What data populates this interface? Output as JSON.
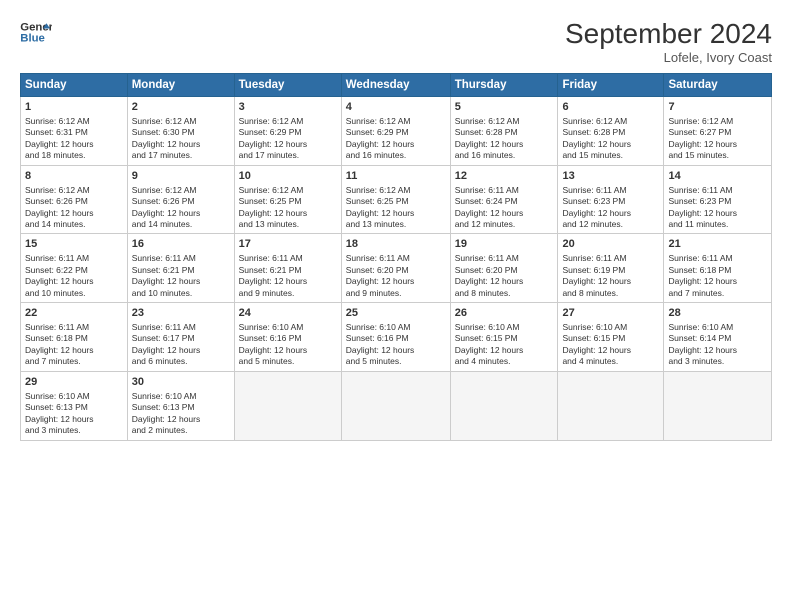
{
  "header": {
    "logo_line1": "General",
    "logo_line2": "Blue",
    "month_title": "September 2024",
    "subtitle": "Lofele, Ivory Coast"
  },
  "weekdays": [
    "Sunday",
    "Monday",
    "Tuesday",
    "Wednesday",
    "Thursday",
    "Friday",
    "Saturday"
  ],
  "weeks": [
    [
      {
        "day": "1",
        "lines": [
          "Sunrise: 6:12 AM",
          "Sunset: 6:31 PM",
          "Daylight: 12 hours",
          "and 18 minutes."
        ]
      },
      {
        "day": "2",
        "lines": [
          "Sunrise: 6:12 AM",
          "Sunset: 6:30 PM",
          "Daylight: 12 hours",
          "and 17 minutes."
        ]
      },
      {
        "day": "3",
        "lines": [
          "Sunrise: 6:12 AM",
          "Sunset: 6:29 PM",
          "Daylight: 12 hours",
          "and 17 minutes."
        ]
      },
      {
        "day": "4",
        "lines": [
          "Sunrise: 6:12 AM",
          "Sunset: 6:29 PM",
          "Daylight: 12 hours",
          "and 16 minutes."
        ]
      },
      {
        "day": "5",
        "lines": [
          "Sunrise: 6:12 AM",
          "Sunset: 6:28 PM",
          "Daylight: 12 hours",
          "and 16 minutes."
        ]
      },
      {
        "day": "6",
        "lines": [
          "Sunrise: 6:12 AM",
          "Sunset: 6:28 PM",
          "Daylight: 12 hours",
          "and 15 minutes."
        ]
      },
      {
        "day": "7",
        "lines": [
          "Sunrise: 6:12 AM",
          "Sunset: 6:27 PM",
          "Daylight: 12 hours",
          "and 15 minutes."
        ]
      }
    ],
    [
      {
        "day": "8",
        "lines": [
          "Sunrise: 6:12 AM",
          "Sunset: 6:26 PM",
          "Daylight: 12 hours",
          "and 14 minutes."
        ]
      },
      {
        "day": "9",
        "lines": [
          "Sunrise: 6:12 AM",
          "Sunset: 6:26 PM",
          "Daylight: 12 hours",
          "and 14 minutes."
        ]
      },
      {
        "day": "10",
        "lines": [
          "Sunrise: 6:12 AM",
          "Sunset: 6:25 PM",
          "Daylight: 12 hours",
          "and 13 minutes."
        ]
      },
      {
        "day": "11",
        "lines": [
          "Sunrise: 6:12 AM",
          "Sunset: 6:25 PM",
          "Daylight: 12 hours",
          "and 13 minutes."
        ]
      },
      {
        "day": "12",
        "lines": [
          "Sunrise: 6:11 AM",
          "Sunset: 6:24 PM",
          "Daylight: 12 hours",
          "and 12 minutes."
        ]
      },
      {
        "day": "13",
        "lines": [
          "Sunrise: 6:11 AM",
          "Sunset: 6:23 PM",
          "Daylight: 12 hours",
          "and 12 minutes."
        ]
      },
      {
        "day": "14",
        "lines": [
          "Sunrise: 6:11 AM",
          "Sunset: 6:23 PM",
          "Daylight: 12 hours",
          "and 11 minutes."
        ]
      }
    ],
    [
      {
        "day": "15",
        "lines": [
          "Sunrise: 6:11 AM",
          "Sunset: 6:22 PM",
          "Daylight: 12 hours",
          "and 10 minutes."
        ]
      },
      {
        "day": "16",
        "lines": [
          "Sunrise: 6:11 AM",
          "Sunset: 6:21 PM",
          "Daylight: 12 hours",
          "and 10 minutes."
        ]
      },
      {
        "day": "17",
        "lines": [
          "Sunrise: 6:11 AM",
          "Sunset: 6:21 PM",
          "Daylight: 12 hours",
          "and 9 minutes."
        ]
      },
      {
        "day": "18",
        "lines": [
          "Sunrise: 6:11 AM",
          "Sunset: 6:20 PM",
          "Daylight: 12 hours",
          "and 9 minutes."
        ]
      },
      {
        "day": "19",
        "lines": [
          "Sunrise: 6:11 AM",
          "Sunset: 6:20 PM",
          "Daylight: 12 hours",
          "and 8 minutes."
        ]
      },
      {
        "day": "20",
        "lines": [
          "Sunrise: 6:11 AM",
          "Sunset: 6:19 PM",
          "Daylight: 12 hours",
          "and 8 minutes."
        ]
      },
      {
        "day": "21",
        "lines": [
          "Sunrise: 6:11 AM",
          "Sunset: 6:18 PM",
          "Daylight: 12 hours",
          "and 7 minutes."
        ]
      }
    ],
    [
      {
        "day": "22",
        "lines": [
          "Sunrise: 6:11 AM",
          "Sunset: 6:18 PM",
          "Daylight: 12 hours",
          "and 7 minutes."
        ]
      },
      {
        "day": "23",
        "lines": [
          "Sunrise: 6:11 AM",
          "Sunset: 6:17 PM",
          "Daylight: 12 hours",
          "and 6 minutes."
        ]
      },
      {
        "day": "24",
        "lines": [
          "Sunrise: 6:10 AM",
          "Sunset: 6:16 PM",
          "Daylight: 12 hours",
          "and 5 minutes."
        ]
      },
      {
        "day": "25",
        "lines": [
          "Sunrise: 6:10 AM",
          "Sunset: 6:16 PM",
          "Daylight: 12 hours",
          "and 5 minutes."
        ]
      },
      {
        "day": "26",
        "lines": [
          "Sunrise: 6:10 AM",
          "Sunset: 6:15 PM",
          "Daylight: 12 hours",
          "and 4 minutes."
        ]
      },
      {
        "day": "27",
        "lines": [
          "Sunrise: 6:10 AM",
          "Sunset: 6:15 PM",
          "Daylight: 12 hours",
          "and 4 minutes."
        ]
      },
      {
        "day": "28",
        "lines": [
          "Sunrise: 6:10 AM",
          "Sunset: 6:14 PM",
          "Daylight: 12 hours",
          "and 3 minutes."
        ]
      }
    ],
    [
      {
        "day": "29",
        "lines": [
          "Sunrise: 6:10 AM",
          "Sunset: 6:13 PM",
          "Daylight: 12 hours",
          "and 3 minutes."
        ]
      },
      {
        "day": "30",
        "lines": [
          "Sunrise: 6:10 AM",
          "Sunset: 6:13 PM",
          "Daylight: 12 hours",
          "and 2 minutes."
        ]
      },
      {
        "day": "",
        "lines": []
      },
      {
        "day": "",
        "lines": []
      },
      {
        "day": "",
        "lines": []
      },
      {
        "day": "",
        "lines": []
      },
      {
        "day": "",
        "lines": []
      }
    ]
  ]
}
